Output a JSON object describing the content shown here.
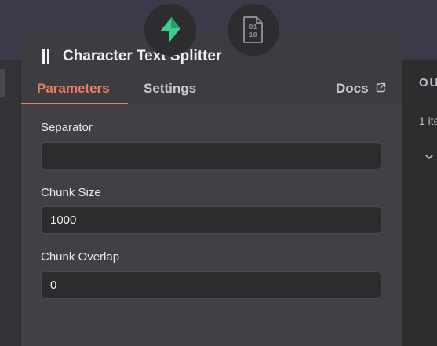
{
  "node": {
    "title": "Character Text Splitter"
  },
  "tabs": {
    "parameters": "Parameters",
    "settings": "Settings",
    "docs": "Docs"
  },
  "fields": {
    "separator": {
      "label": "Separator",
      "value": ""
    },
    "chunk_size": {
      "label": "Chunk Size",
      "value": "1000"
    },
    "chunk_overlap": {
      "label": "Chunk Overlap",
      "value": "0"
    }
  },
  "output_panel": {
    "title": "OU",
    "items": "1 ite"
  },
  "icons": {
    "supabase": "lightning-bolt-icon",
    "binary": "binary-file-icon",
    "drag": "drag-handle-icon",
    "external": "external-link-icon",
    "chevron": "chevron-down-icon"
  },
  "colors": {
    "accent": "#f07c62",
    "supabase_green": "#3ecf8e"
  }
}
